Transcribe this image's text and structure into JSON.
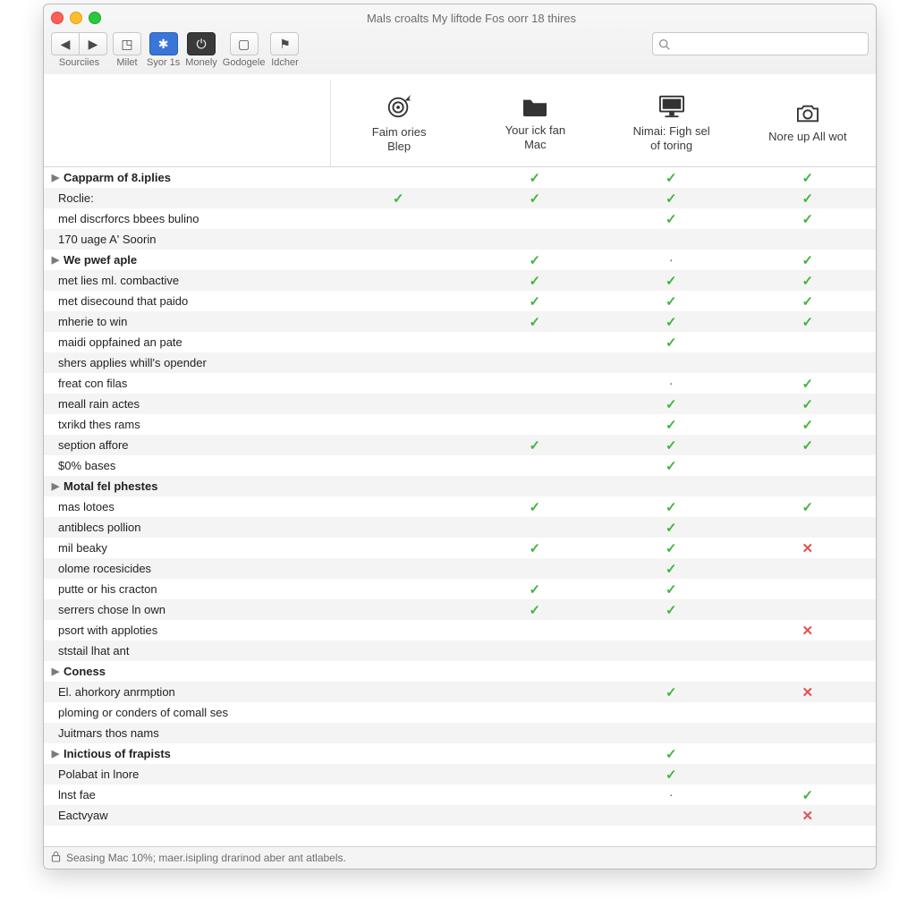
{
  "window": {
    "title": "Mals croalts My liftode Fos oorr 18 thires"
  },
  "search": {
    "value": ""
  },
  "toolbar": {
    "items": [
      {
        "label": "Sourciies"
      },
      {
        "label": "Milet"
      },
      {
        "label": "Syor 1s"
      },
      {
        "label": "Monely"
      },
      {
        "label": "Godogele"
      },
      {
        "label": "Idcher"
      }
    ]
  },
  "columns": [
    {
      "line1": "Faim ories",
      "line2": "Blep"
    },
    {
      "line1": "Your ick fan",
      "line2": "Mac"
    },
    {
      "line1": "Nimai: Figh sel",
      "line2": "of toring"
    },
    {
      "line1": "Nore up All wot",
      "line2": ""
    }
  ],
  "marks": {
    "check": "✓",
    "cross": "✕",
    "dot": "·"
  },
  "rows": [
    {
      "group": true,
      "label": "Capparm of 8.iplies",
      "cells": [
        "",
        "check",
        "check",
        "check"
      ]
    },
    {
      "group": false,
      "label": "Roclie:",
      "cells": [
        "check",
        "check",
        "check",
        "check"
      ]
    },
    {
      "group": false,
      "label": "mel discrforcs bbees bulino",
      "cells": [
        "",
        "",
        "check",
        "check"
      ]
    },
    {
      "group": false,
      "label": "170 uage A' Soorin",
      "cells": [
        "",
        "",
        "",
        ""
      ]
    },
    {
      "group": true,
      "label": "We pwef aple",
      "cells": [
        "",
        "check",
        "dot",
        "check"
      ]
    },
    {
      "group": false,
      "label": "met lies ml. combactive",
      "cells": [
        "",
        "check",
        "check",
        "check"
      ]
    },
    {
      "group": false,
      "label": "met disecound that paido",
      "cells": [
        "",
        "check",
        "check",
        "check"
      ]
    },
    {
      "group": false,
      "label": "mherie to win",
      "cells": [
        "",
        "check",
        "check",
        "check"
      ]
    },
    {
      "group": false,
      "label": "maidi oppfained an pate",
      "cells": [
        "",
        "",
        "check",
        ""
      ]
    },
    {
      "group": false,
      "label": "shers applies whill's opender",
      "cells": [
        "",
        "",
        "",
        ""
      ]
    },
    {
      "group": false,
      "label": "freat con filas",
      "cells": [
        "",
        "",
        "dot",
        "check"
      ]
    },
    {
      "group": false,
      "label": "meall rain actes",
      "cells": [
        "",
        "",
        "check",
        "check"
      ]
    },
    {
      "group": false,
      "label": "txrikd thes rams",
      "cells": [
        "",
        "",
        "check",
        "check"
      ]
    },
    {
      "group": false,
      "label": "seption affore",
      "cells": [
        "",
        "check",
        "check",
        "check"
      ]
    },
    {
      "group": false,
      "label": "$0% bases",
      "cells": [
        "",
        "",
        "check",
        ""
      ]
    },
    {
      "group": true,
      "label": "Motal fel phestes",
      "cells": [
        "",
        "",
        "",
        ""
      ]
    },
    {
      "group": false,
      "label": "mas lotoes",
      "cells": [
        "",
        "check",
        "check",
        "check"
      ]
    },
    {
      "group": false,
      "label": "antiblecs pollion",
      "cells": [
        "",
        "",
        "check",
        ""
      ]
    },
    {
      "group": false,
      "label": "mil beaky",
      "cells": [
        "",
        "check",
        "check",
        "cross"
      ]
    },
    {
      "group": false,
      "label": "olome rocesicides",
      "cells": [
        "",
        "",
        "check",
        ""
      ]
    },
    {
      "group": false,
      "label": "putte or his cracton",
      "cells": [
        "",
        "check",
        "check",
        ""
      ]
    },
    {
      "group": false,
      "label": "serrers chose ln own",
      "cells": [
        "",
        "check",
        "check",
        ""
      ]
    },
    {
      "group": false,
      "label": "psort with apploties",
      "cells": [
        "",
        "",
        "",
        "cross"
      ]
    },
    {
      "group": false,
      "label": "ststail lhat ant",
      "cells": [
        "",
        "",
        "",
        ""
      ]
    },
    {
      "group": true,
      "label": "Coness",
      "cells": [
        "",
        "",
        "",
        ""
      ]
    },
    {
      "group": false,
      "label": "El. ahorkory anrmption",
      "cells": [
        "",
        "",
        "check",
        "cross"
      ]
    },
    {
      "group": false,
      "label": "ploming or conders of comall ses",
      "cells": [
        "",
        "",
        "",
        ""
      ]
    },
    {
      "group": false,
      "label": "Juitmars thos nams",
      "cells": [
        "",
        "",
        "",
        ""
      ]
    },
    {
      "group": true,
      "label": "Inictious of frapists",
      "cells": [
        "",
        "",
        "check",
        ""
      ]
    },
    {
      "group": false,
      "label": "Polabat in lnore",
      "cells": [
        "",
        "",
        "check",
        ""
      ]
    },
    {
      "group": false,
      "label": "lnst fae",
      "cells": [
        "",
        "",
        "dot",
        "check"
      ]
    },
    {
      "group": false,
      "label": "Eactvyaw",
      "cells": [
        "",
        "",
        "",
        "cross"
      ]
    }
  ],
  "status": "Seasing Mac 10%; maer.isipling drarinod aber ant atlabels."
}
